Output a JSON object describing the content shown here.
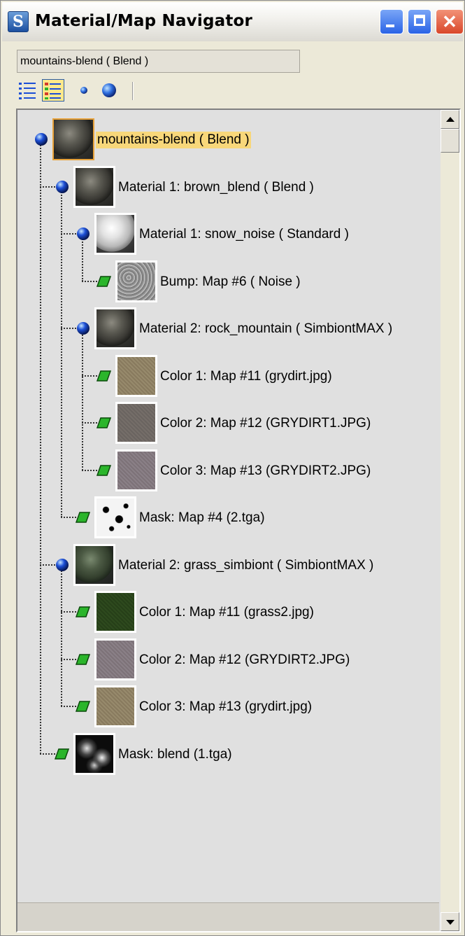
{
  "window": {
    "title": "Material/Map Navigator",
    "icon": "3ds-max-logo",
    "icon_glyph": "S"
  },
  "name_field": {
    "value": "mountains-blend  ( Blend )"
  },
  "toolbar": {
    "buttons": [
      {
        "name": "view-list",
        "icon": "list-icon",
        "active": false
      },
      {
        "name": "view-list-icons",
        "icon": "list-icons-icon",
        "active": true
      },
      {
        "name": "view-small-icons",
        "icon": "small-sphere-icon",
        "active": false
      },
      {
        "name": "view-large-icons",
        "icon": "large-sphere-icon",
        "active": false
      }
    ]
  },
  "colors": {
    "selection": "#f8d77a",
    "material_node": "#1c4fd6",
    "map_node": "#2bb52b"
  },
  "tree": [
    {
      "label": "mountains-blend  ( Blend )",
      "depth": 0,
      "kind": "material",
      "swatch": "rock-dark",
      "selected": true
    },
    {
      "label": "Material 1: brown_blend  ( Blend )",
      "depth": 1,
      "kind": "material",
      "swatch": "rock-dark",
      "selected": false
    },
    {
      "label": "Material 1: snow_noise  ( Standard )",
      "depth": 2,
      "kind": "material",
      "swatch": "snow",
      "selected": false
    },
    {
      "label": "Bump: Map #6  ( Noise )",
      "depth": 3,
      "kind": "map",
      "swatch": "noise",
      "selected": false
    },
    {
      "label": "Material 2: rock_mountain  ( SimbiontMAX )",
      "depth": 2,
      "kind": "material",
      "swatch": "rock-dark",
      "selected": false
    },
    {
      "label": "Color 1: Map #11 (grydirt.jpg)",
      "depth": 3,
      "kind": "map",
      "swatch": "dirt-tan",
      "selected": false
    },
    {
      "label": "Color 2: Map #12 (GRYDIRT1.JPG)",
      "depth": 3,
      "kind": "map",
      "swatch": "dirt-gray",
      "selected": false
    },
    {
      "label": "Color 3: Map #13 (GRYDIRT2.JPG)",
      "depth": 3,
      "kind": "map",
      "swatch": "dirt-mauve",
      "selected": false
    },
    {
      "label": "Mask: Map #4 (2.tga)",
      "depth": 2,
      "kind": "map",
      "swatch": "mask-spots",
      "selected": false
    },
    {
      "label": "Material 2: grass_simbiont  ( SimbiontMAX )",
      "depth": 1,
      "kind": "material",
      "swatch": "rock-green",
      "selected": false
    },
    {
      "label": "Color 1: Map #11 (grass2.jpg)",
      "depth": 2,
      "kind": "map",
      "swatch": "grass",
      "selected": false
    },
    {
      "label": "Color 2: Map #12 (GRYDIRT2.JPG)",
      "depth": 2,
      "kind": "map",
      "swatch": "dirt-mauve",
      "selected": false
    },
    {
      "label": "Color 3: Map #13 (grydirt.jpg)",
      "depth": 2,
      "kind": "map",
      "swatch": "dirt-tan",
      "selected": false
    },
    {
      "label": "Mask: blend (1.tga)",
      "depth": 1,
      "kind": "map",
      "swatch": "mask-blur",
      "selected": false
    }
  ],
  "scrollbar": {
    "up_icon": "arrow-up-icon",
    "down_icon": "arrow-down-icon"
  }
}
